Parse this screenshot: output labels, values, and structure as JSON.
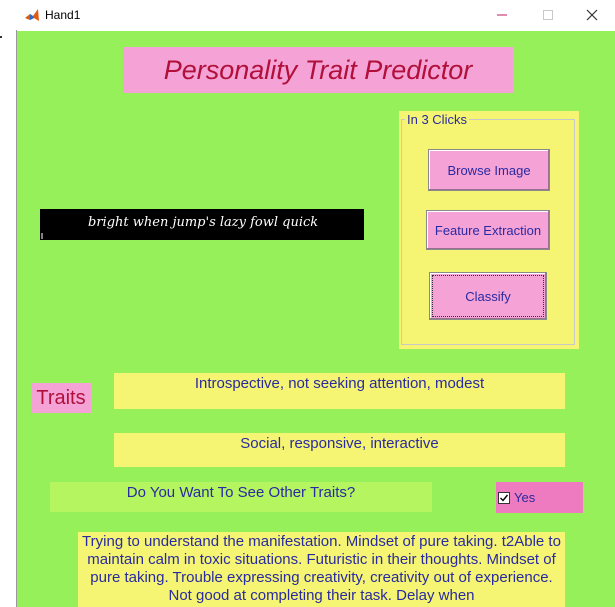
{
  "window": {
    "title": "Hand1"
  },
  "header": {
    "title": "Personality Trait Predictor"
  },
  "steps_panel": {
    "label": "In 3 Clicks",
    "browse_label": "Browse Image",
    "feature_label": "Feature Extraction",
    "classify_label": "Classify"
  },
  "handwriting": {
    "text": "bright when jump's lazy fowl quick"
  },
  "traits": {
    "label": "Traits",
    "trait_1": "Introspective, not seeking attention, modest",
    "trait_2": "Social, responsive, interactive"
  },
  "other": {
    "question": "Do You Want To See Other Traits?",
    "checkbox_label": "Yes",
    "checkbox_checked": true,
    "details": "Trying to understand the manifestation. Mindset of pure taking. t2Able to maintain calm in toxic situations. Futuristic in their thoughts. Mindset of pure taking. Trouble expressing creativity, creativity out of experience. Not good at completing their task. Delay when"
  },
  "colors": {
    "background": "#96f05a",
    "pink": "#f5a2d6",
    "yellow": "#f5f573",
    "text_blue": "#2a2aa0",
    "title_red": "#b0103a"
  }
}
